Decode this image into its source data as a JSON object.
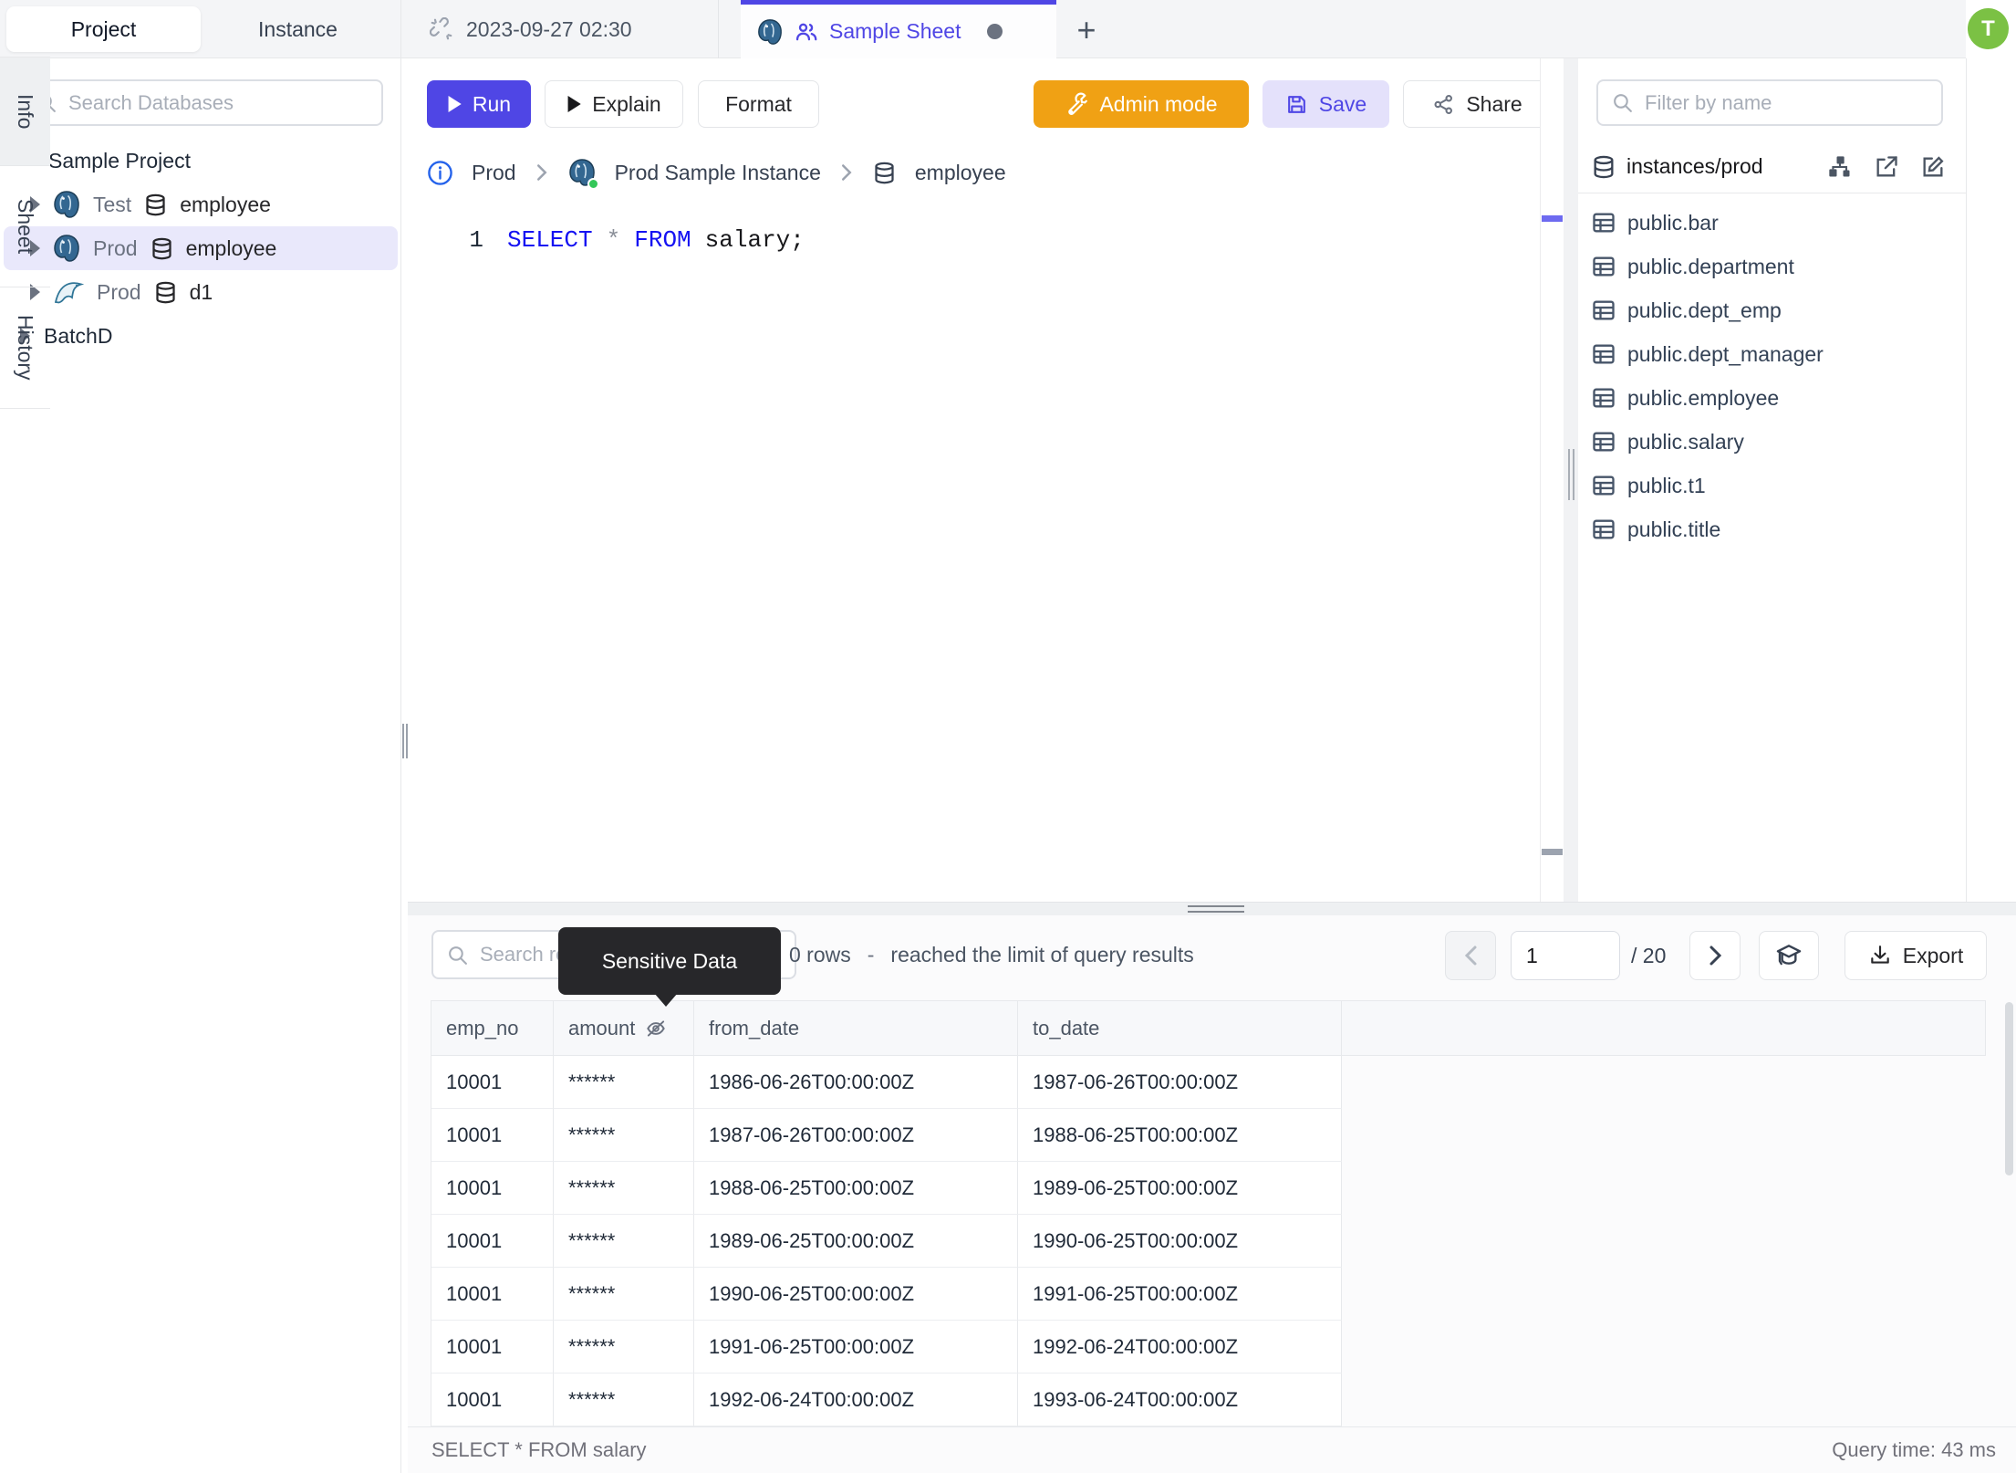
{
  "sidebar": {
    "tabs": {
      "project": "Project",
      "instance": "Instance"
    },
    "search_placeholder": "Search Databases",
    "tree": {
      "project_label": "Sample Project",
      "items": [
        {
          "env": "Test",
          "db": "employee",
          "engine": "postgres"
        },
        {
          "env": "Prod",
          "db": "employee",
          "engine": "postgres"
        },
        {
          "env": "Prod",
          "db": "d1",
          "engine": "mysql"
        }
      ],
      "batch_label": "BatchD"
    }
  },
  "tabbar": {
    "tab1_label": "2023-09-27 02:30",
    "tab2_label": "Sample Sheet",
    "new_tab_label": "+"
  },
  "avatar": {
    "initial": "T"
  },
  "toolbar": {
    "run": "Run",
    "explain": "Explain",
    "format": "Format",
    "admin_mode": "Admin mode",
    "save": "Save",
    "share": "Share"
  },
  "breadcrumb": {
    "env": "Prod",
    "instance": "Prod Sample Instance",
    "database": "employee"
  },
  "editor": {
    "line_number": "1",
    "keyword_select": "SELECT",
    "star": "*",
    "keyword_from": "FROM",
    "tail": "salary;"
  },
  "right_panel": {
    "filter_placeholder": "Filter by name",
    "source_label": "instances/prod",
    "tables": [
      "public.bar",
      "public.department",
      "public.dept_emp",
      "public.dept_manager",
      "public.employee",
      "public.salary",
      "public.t1",
      "public.title"
    ]
  },
  "side_tabs": {
    "info": "Info",
    "sheet": "Sheet",
    "history": "History"
  },
  "results": {
    "search_placeholder": "Search results",
    "tooltip": "Sensitive Data",
    "rows_count": "0 rows",
    "dash": "-",
    "limit_text": "reached the limit of query results",
    "page": "1",
    "page_total": "/ 20",
    "export_label": "Export",
    "columns": {
      "c1": "emp_no",
      "c2": "amount",
      "c3": "from_date",
      "c4": "to_date"
    },
    "rows": [
      [
        "10001",
        "******",
        "1986-06-26T00:00:00Z",
        "1987-06-26T00:00:00Z"
      ],
      [
        "10001",
        "******",
        "1987-06-26T00:00:00Z",
        "1988-06-25T00:00:00Z"
      ],
      [
        "10001",
        "******",
        "1988-06-25T00:00:00Z",
        "1989-06-25T00:00:00Z"
      ],
      [
        "10001",
        "******",
        "1989-06-25T00:00:00Z",
        "1990-06-25T00:00:00Z"
      ],
      [
        "10001",
        "******",
        "1990-06-25T00:00:00Z",
        "1991-06-25T00:00:00Z"
      ],
      [
        "10001",
        "******",
        "1991-06-25T00:00:00Z",
        "1992-06-24T00:00:00Z"
      ],
      [
        "10001",
        "******",
        "1992-06-24T00:00:00Z",
        "1993-06-24T00:00:00Z"
      ]
    ],
    "status_left": "SELECT * FROM salary",
    "status_right": "Query time: 43 ms"
  },
  "colors": {
    "accent_indigo": "#4f46e5",
    "admin_orange": "#f0a114",
    "avatar_green": "#7bc144",
    "keyword_blue": "#1512f2",
    "selected_row": "#e9e8fb",
    "tooltip_bg": "#27272a",
    "status_green_dot": "#34c759"
  }
}
